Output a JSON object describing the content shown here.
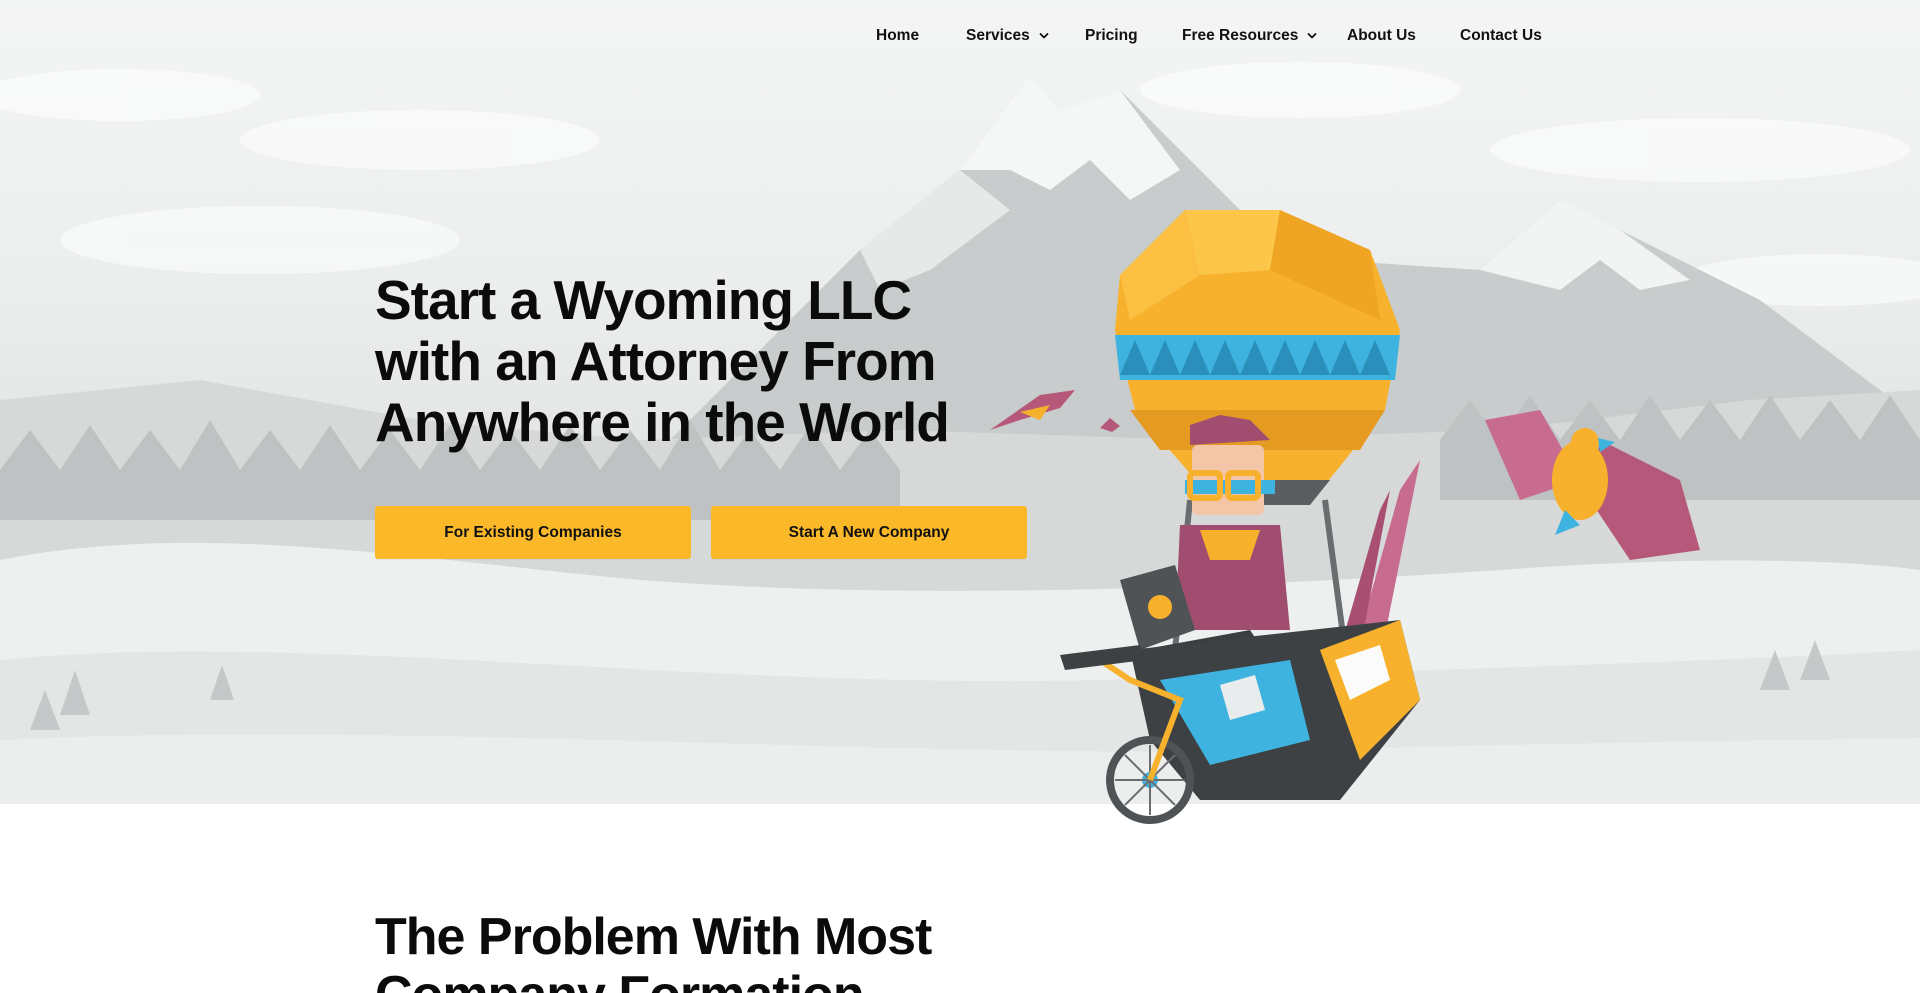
{
  "nav": {
    "items": [
      {
        "label": "Home",
        "dropdown": false
      },
      {
        "label": "Services",
        "dropdown": true
      },
      {
        "label": "Pricing",
        "dropdown": false
      },
      {
        "label": "Free Resources",
        "dropdown": true
      },
      {
        "label": "About Us",
        "dropdown": false
      },
      {
        "label": "Contact Us",
        "dropdown": false
      }
    ]
  },
  "hero": {
    "headline_lines": [
      "Start a Wyoming LLC",
      "with an Attorney From",
      "Anywhere in the World"
    ],
    "buttons": {
      "existing": "For Existing Companies",
      "new": "Start A New Company"
    },
    "illustration_icon": "hot-air-balloon-illustration"
  },
  "section2": {
    "title_lines": [
      "The Problem With Most",
      "Company Formation"
    ]
  },
  "colors": {
    "accent": "#fbb828",
    "text": "#0b0b0b",
    "hero_bg": "#eceeee"
  }
}
